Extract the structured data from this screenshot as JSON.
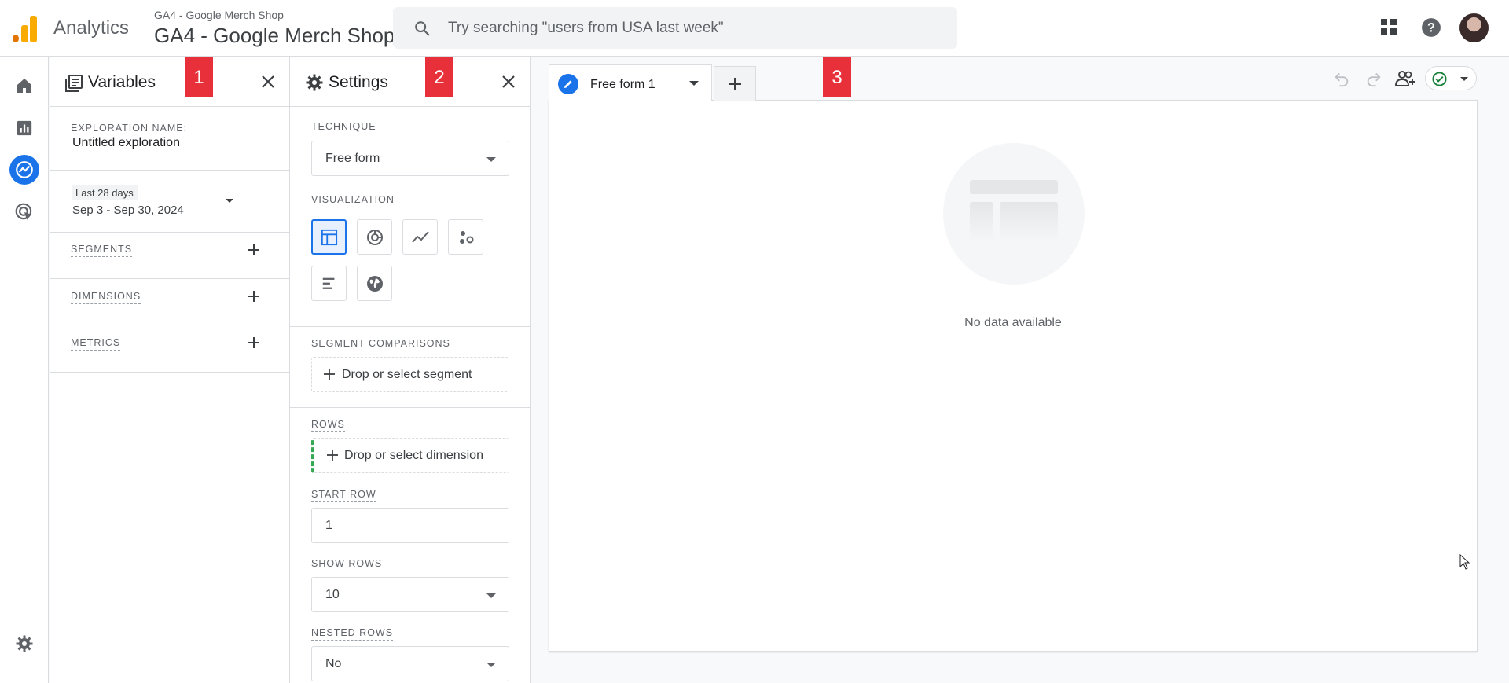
{
  "header": {
    "app_name": "Analytics",
    "property_small": "GA4 - Google Merch Shop",
    "property_big": "GA4 - Google Merch Shop",
    "search_placeholder": "Try searching \"users from USA last week\""
  },
  "icons": {
    "logo": "analytics-logo-icon",
    "search": "search-icon",
    "apps": "apps-grid-icon",
    "help": "help-icon",
    "home": "home-icon",
    "reports": "reports-icon",
    "explore": "explore-icon",
    "advertising": "advertising-icon",
    "admin": "gear-icon"
  },
  "colors": {
    "accent": "#1a73e8",
    "badge": "#e8303a",
    "logo_orange": "#f9ab00",
    "logo_dark": "#e37400"
  },
  "variables": {
    "title": "Variables",
    "badge": "1",
    "exploration_name_label": "EXPLORATION NAME:",
    "exploration_name": "Untitled exploration",
    "date_chip": "Last 28 days",
    "date_range": "Sep 3 - Sep 30, 2024",
    "segments_label": "SEGMENTS",
    "dimensions_label": "DIMENSIONS",
    "metrics_label": "METRICS"
  },
  "settings": {
    "title": "Settings",
    "badge": "2",
    "technique_label": "TECHNIQUE",
    "technique_value": "Free form",
    "visualization_label": "VISUALIZATION",
    "visualization_options": [
      "table-icon",
      "donut-chart-icon",
      "line-chart-icon",
      "scatter-plot-icon",
      "bar-chart-icon",
      "geo-map-icon"
    ],
    "segment_comparisons_label": "SEGMENT COMPARISONS",
    "segment_drop": "Drop or select segment",
    "rows_label": "ROWS",
    "rows_drop": "Drop or select dimension",
    "start_row_label": "START ROW",
    "start_row_value": "1",
    "show_rows_label": "SHOW ROWS",
    "show_rows_value": "10",
    "nested_rows_label": "NESTED ROWS",
    "nested_rows_value": "No"
  },
  "canvas": {
    "tab_label": "Free form 1",
    "badge": "3",
    "empty_text": "No data available"
  }
}
